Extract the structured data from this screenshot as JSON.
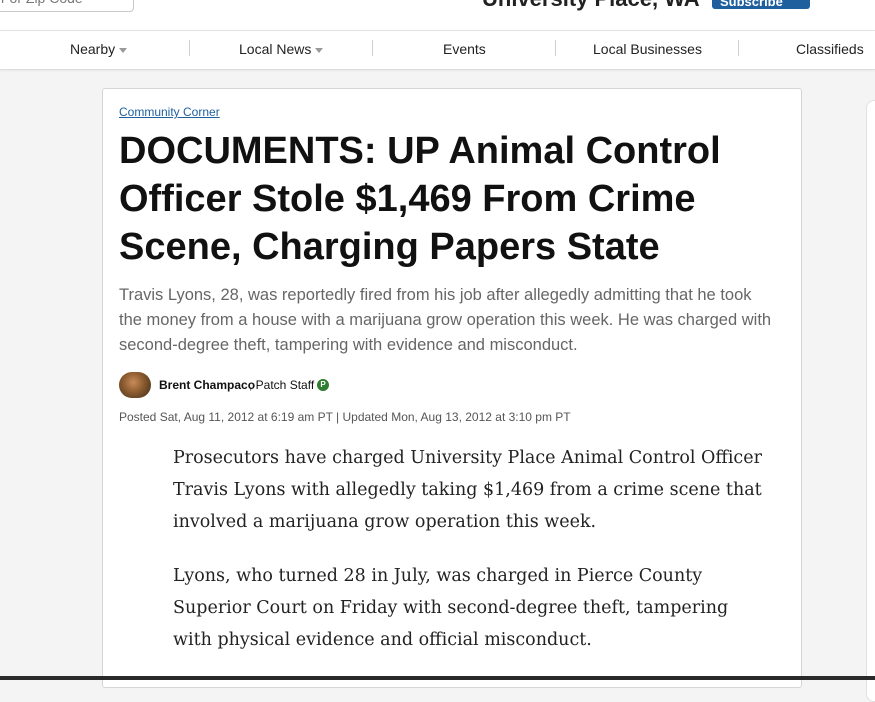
{
  "header": {
    "zip_value": "r or Zip Code",
    "site_title": "University Place, WA",
    "subscribe_label": "Subscribe"
  },
  "nav": {
    "items": [
      {
        "label": "Nearby"
      },
      {
        "label": "Local News"
      },
      {
        "label": "Events"
      },
      {
        "label": "Local Businesses"
      },
      {
        "label": "Classifieds"
      }
    ]
  },
  "article": {
    "category": "Community Corner",
    "headline": "DOCUMENTS: UP Animal Control Officer Stole $1,469 From Crime Scene, Charging Papers State",
    "deck": "Travis Lyons, 28, was reportedly fired from his job after allegedly admitting that he took the money from a house with a marijuana grow operation this week. He was charged with second-degree theft, tampering with evidence and misconduct.",
    "author": {
      "name": "Brent Champaco",
      "role": ", Patch Staff",
      "badge": "P"
    },
    "timestamps": "Posted Sat, Aug 11, 2012 at 6:19 am PT  |  Updated Mon, Aug 13, 2012 at 3:10 pm PT",
    "paragraphs": [
      "Prosecutors have charged University Place Animal Control Officer Travis Lyons with allegedly taking $1,469 from a crime scene that involved a marijuana grow operation this week.",
      "Lyons, who turned 28 in July, was charged in Pierce County Superior Court on Friday with second-degree theft, tampering with physical evidence and official misconduct."
    ]
  },
  "colors": {
    "brand_blue": "#1f5f9e",
    "staff_badge": "#2e7d32"
  }
}
